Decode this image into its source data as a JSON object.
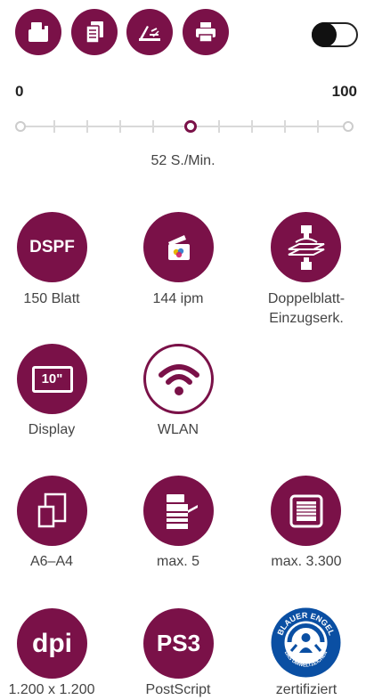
{
  "modes": [
    {
      "icon": "copier-icon"
    },
    {
      "icon": "documents-icon"
    },
    {
      "icon": "scanner-icon"
    },
    {
      "icon": "printer-icon"
    }
  ],
  "toggle": {
    "state": "on",
    "icon": "toggle-icon"
  },
  "speed_slider": {
    "min_label": "0",
    "max_label": "100",
    "value": 52,
    "value_label": "52 S./Min.",
    "accent": "#7a1148"
  },
  "features": [
    {
      "icon_text": "DSPF",
      "label": "150 Blatt"
    },
    {
      "icon": "color-scan-icon",
      "label": "144 ipm"
    },
    {
      "icon": "double-feed-detection-icon",
      "label_line1": "Doppelblatt-",
      "label_line2": "Einzugserk."
    },
    {
      "icon_text": "10\"",
      "label": "Display"
    },
    {
      "icon": "wifi-icon",
      "label": "WLAN"
    },
    {
      "icon": "paper-size-icon",
      "label": "A6–A4"
    },
    {
      "icon": "paper-trays-icon",
      "label": "max. 5"
    },
    {
      "icon": "paper-capacity-icon",
      "label": "max. 3.300"
    },
    {
      "icon_text": "dpi",
      "label": "1.200 x 1.200"
    },
    {
      "icon_text": "PS3",
      "label": "PostScript"
    },
    {
      "icon": "blauer-engel-seal",
      "seal_top": "BLAUER ENGEL",
      "seal_bottom": "DAS UMWELTZEICHEN",
      "label": "zertifiziert"
    }
  ]
}
